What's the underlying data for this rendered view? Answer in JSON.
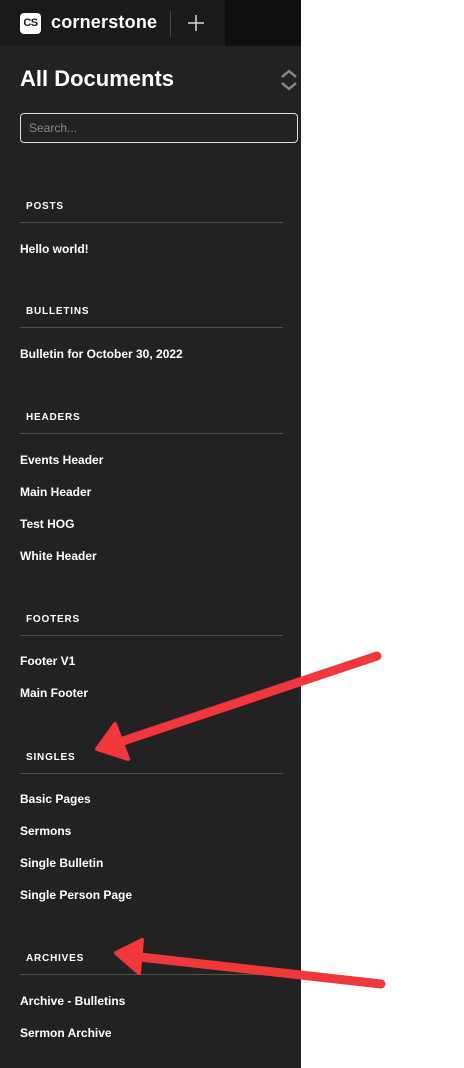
{
  "app": {
    "brand": "cornerstone",
    "logo_text": "CS"
  },
  "header": {
    "title": "All Documents"
  },
  "search": {
    "placeholder": "Search..."
  },
  "sections": {
    "posts": {
      "title": "POSTS",
      "items": [
        "Hello world!"
      ]
    },
    "bulletins": {
      "title": "BULLETINS",
      "items": [
        "Bulletin for October 30, 2022"
      ]
    },
    "headers": {
      "title": "HEADERS",
      "items": [
        "Events Header",
        "Main Header",
        "Test HOG",
        "White Header"
      ]
    },
    "footers": {
      "title": "FOOTERS",
      "items": [
        "Footer V1",
        "Main Footer"
      ]
    },
    "singles": {
      "title": "SINGLES",
      "items": [
        "Basic Pages",
        "Sermons",
        "Single Bulletin",
        "Single Person Page"
      ]
    },
    "archives": {
      "title": "ARCHIVES",
      "items": [
        "Archive - Bulletins",
        "Sermon Archive"
      ]
    }
  },
  "colors": {
    "sidebar_bg": "#222222",
    "topbar_bg": "#1a1a1a",
    "annotation_arrow": "#f0383b",
    "text": "#ffffff"
  },
  "icons": [
    "cornerstone-logo-icon",
    "plus-icon",
    "sort-toggle-icon",
    "annotation-arrow-icon"
  ]
}
